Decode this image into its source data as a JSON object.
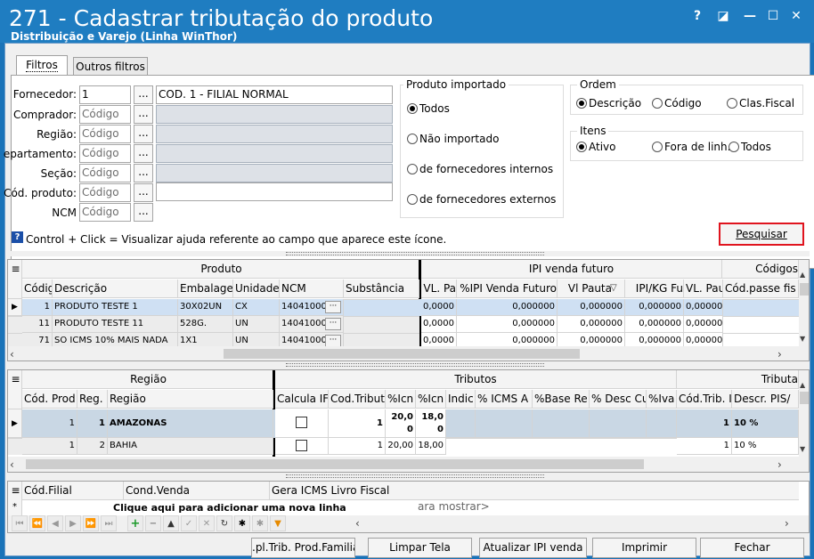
{
  "window": {
    "title": "271 - Cadastrar tributação do produto",
    "subtitle": "Distribuição e Varejo (Linha WinThor)",
    "help_glyph": "?",
    "restore_glyph": "◪",
    "minimize_glyph": "—",
    "maximize_glyph": "☐",
    "close_glyph": "✕"
  },
  "tabs": [
    "Filtros",
    "Outros filtros"
  ],
  "filters": {
    "fornecedor": {
      "label": "Fornecedor:",
      "value": "1",
      "desc": "COD. 1 - FILIAL NORMAL"
    },
    "comprador": {
      "label": "Comprador:",
      "placeholder": "Código"
    },
    "regiao": {
      "label": "Região:",
      "placeholder": "Código"
    },
    "departamento": {
      "label": "epartamento:",
      "placeholder": "Código"
    },
    "secao": {
      "label": "Seção:",
      "placeholder": "Código"
    },
    "cod_produto": {
      "label": "Cód. produto:",
      "placeholder": "Código"
    },
    "ncm": {
      "label": "NCM",
      "placeholder": "Código"
    },
    "dots": "..."
  },
  "produto_importado": {
    "title": "Produto importado",
    "options": [
      "Todos",
      "Não importado",
      "de fornecedores internos",
      "de fornecedores externos"
    ],
    "selected": 0
  },
  "ordem": {
    "title": "Ordem",
    "options": [
      "Descrição",
      "Código",
      "Clas.Fiscal"
    ],
    "selected": 0
  },
  "itens": {
    "title": "Itens",
    "options": [
      "Ativo",
      "Fora de linh.",
      "Todos"
    ],
    "selected": 0
  },
  "help_text": "Control + Click = Visualizar ajuda referente ao campo que aparece este ícone.",
  "buttons": {
    "pesquisar": "Pesquisar",
    "prod_familia": ".pl.Trib. Prod.Familia",
    "limpar_tela": "Limpar Tela",
    "atualizar_ipi": "Atualizar IPI venda",
    "imprimir": "Imprimir",
    "fechar": "Fechar"
  },
  "grid1": {
    "bands": [
      "Produto",
      "IPI venda futuro",
      "Códigos"
    ],
    "columns": [
      "Códig",
      "Descrição",
      "Embalage",
      "Unidade",
      "NCM",
      "Substância",
      "VL. Pa",
      "%IPI Venda Futuro",
      "Vl Pauta",
      "IPI/KG Fu",
      "VL. Pau",
      "Cód.passe fis"
    ],
    "rows": [
      [
        "1",
        "PRODUTO TESTE 1",
        "30X02UN",
        "CX",
        "14041000",
        "",
        "0,0000",
        "0,000000",
        "0,000000",
        "0,000000",
        "0,00000",
        ""
      ],
      [
        "11",
        "PRODUTO TESTE 11",
        "528G.",
        "UN",
        "14041000",
        "",
        "0,0000",
        "0,000000",
        "0,000000",
        "0,000000",
        "0,00000",
        ""
      ],
      [
        "71",
        "SO ICMS 10% MAIS NADA",
        "1X1",
        "UN",
        "14041000",
        "",
        "0,0000",
        "0,000000",
        "0,000000",
        "0,000000",
        "0,00000",
        ""
      ]
    ]
  },
  "grid2": {
    "bands": [
      "Região",
      "Tributos",
      "Tributa"
    ],
    "columns": [
      "Cód. Prod",
      "Reg.",
      "Região",
      "Calcula IF",
      "Cod.Tribut",
      "%Icn",
      "%Icn",
      "Indic",
      "% ICMS A",
      "%Base Re",
      "% Desc Cu",
      "%Iva",
      "Cód.Trib. I",
      "Descr. PIS/"
    ],
    "rows": [
      [
        "1",
        "1",
        "AMAZONAS",
        "",
        "1",
        "20,00",
        "18,00",
        "",
        "",
        "",
        "",
        "",
        "1",
        "10 %"
      ],
      [
        "1",
        "2",
        "BAHIA",
        "",
        "1",
        "20,00",
        "18,00",
        "",
        "",
        "",
        "",
        "",
        "1",
        "10 %"
      ]
    ]
  },
  "grid3": {
    "columns": [
      "Cód.Filial",
      "Cond.Venda",
      "Gera ICMS Livro Fiscal"
    ],
    "new_row_marker": "*",
    "new_row_text": "Clique aqui para adicionar uma nova linha",
    "empty_text": "ara mostrar>"
  },
  "navigator": [
    "⏮",
    "⏪",
    "◀",
    "▶",
    "⏩",
    "⏭",
    "+",
    "−",
    "▲",
    "✓",
    "✕",
    "↻",
    "✱",
    "✱",
    "▼"
  ]
}
